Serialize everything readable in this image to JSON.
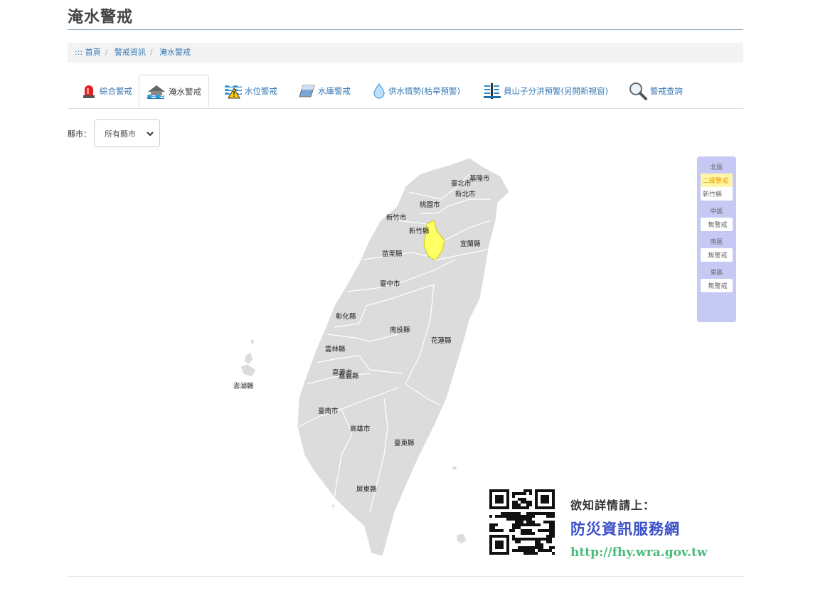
{
  "page": {
    "title": "淹水警戒"
  },
  "breadcrumb": {
    "prefix": ":::",
    "home": "首頁",
    "level1": "警戒資訊",
    "current": "淹水警戒"
  },
  "tabs": [
    {
      "label": "綜合警戒",
      "icon": "siren-icon"
    },
    {
      "label": "淹水警戒",
      "icon": "flood-house-icon"
    },
    {
      "label": "水位警戒",
      "icon": "water-level-warning-icon"
    },
    {
      "label": "水庫警戒",
      "icon": "reservoir-icon"
    },
    {
      "label": "供水情勢(枯旱預警)",
      "icon": "water-drop-icon"
    },
    {
      "label": "員山子分洪預警(另開新視窗)",
      "icon": "diversion-gauge-icon"
    },
    {
      "label": "警戒查詢",
      "icon": "magnifier-icon"
    }
  ],
  "filter": {
    "label": "縣市：",
    "selected": "所有縣市"
  },
  "map": {
    "highlight_color": "#ffff66",
    "base_color": "#dcdcdc",
    "labels": {
      "keelung": "基隆市",
      "taipei": "臺北市",
      "newtaipei": "新北市",
      "taoyuan": "桃園市",
      "hsinchucity": "新竹市",
      "hsinchucounty": "新竹縣",
      "yilan": "宜蘭縣",
      "miaoli": "苗栗縣",
      "taichung": "臺中市",
      "changhua": "彰化縣",
      "nantou": "南投縣",
      "hualien": "花蓮縣",
      "yunlin": "雲林縣",
      "chiayicity": "嘉義市",
      "chiayicounty": "嘉義縣",
      "penghu": "澎湖縣",
      "tainan": "臺南市",
      "kaohsiung": "高雄市",
      "taitung": "臺東縣",
      "pingtung": "屏東縣"
    }
  },
  "legend": {
    "north": {
      "title": "北區",
      "level": "二級警戒",
      "county": "新竹縣"
    },
    "central": {
      "title": "中區",
      "value": "無警戒"
    },
    "south": {
      "title": "南區",
      "value": "無警戒"
    },
    "east": {
      "title": "東區",
      "value": "無警戒"
    }
  },
  "promo": {
    "line1": "欲知詳情請上：",
    "line2": "防災資訊服務網",
    "url": "http://fhy.wra.gov.tw"
  }
}
